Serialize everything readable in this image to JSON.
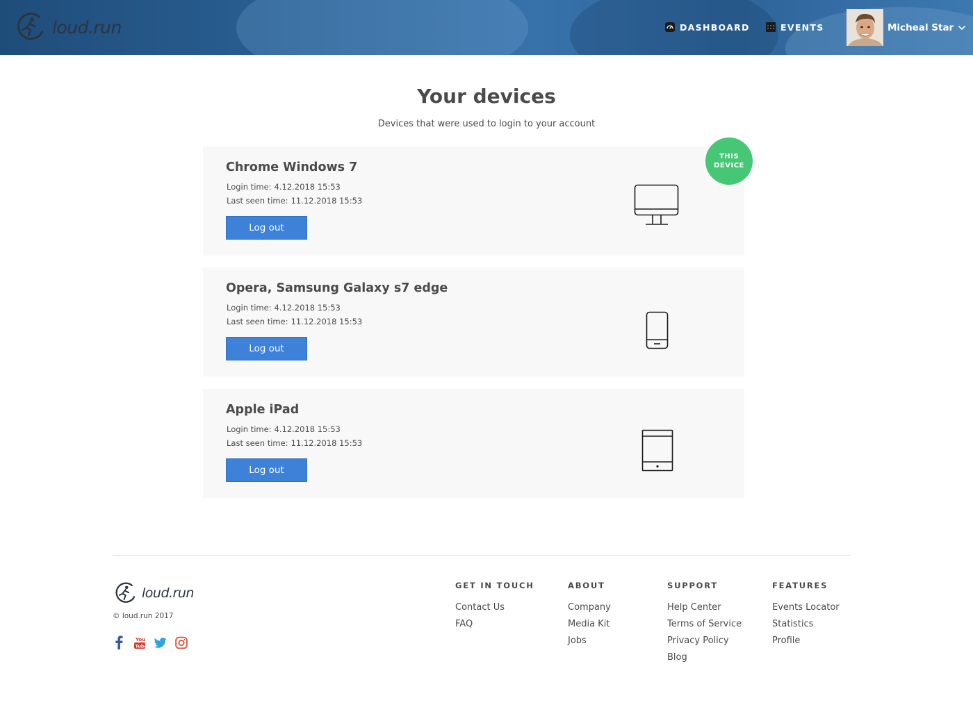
{
  "brand": {
    "name": "loud.run"
  },
  "nav": [
    {
      "label": "DASHBOARD",
      "icon": "dashboard-gauge-icon"
    },
    {
      "label": "EVENTS",
      "icon": "calendar-grid-icon"
    }
  ],
  "user": {
    "name": "Micheal Star"
  },
  "main": {
    "title": "Your devices",
    "subtitle": "Devices that were used to login to your account",
    "this_device_label": "THIS DEVICE",
    "devices": [
      {
        "name": "Chrome Windows 7",
        "login_label": "Login time:",
        "login_time": "4.12.2018 15:53",
        "seen_label": "Last seen time:",
        "seen_time": "11.12.2018 15:53",
        "button": "Log out",
        "icon": "desktop-monitor-icon"
      },
      {
        "name": "Opera, Samsung Galaxy s7 edge",
        "login_label": "Login time:",
        "login_time": "4.12.2018 15:53",
        "seen_label": "Last seen time:",
        "seen_time": "11.12.2018 15:53",
        "button": "Log out",
        "icon": "smartphone-icon"
      },
      {
        "name": "Apple iPad",
        "login_label": "Login time:",
        "login_time": "4.12.2018 15:53",
        "seen_label": "Last seen time:",
        "seen_time": "11.12.2018 15:53",
        "button": "Log out",
        "icon": "tablet-icon"
      }
    ]
  },
  "footer": {
    "copyright": "© loud.run 2017",
    "socials": [
      "facebook-icon",
      "youtube-icon",
      "twitter-icon",
      "instagram-icon"
    ],
    "columns": [
      {
        "heading": "GET IN TOUCH",
        "links": [
          "Contact Us",
          "FAQ"
        ]
      },
      {
        "heading": "ABOUT",
        "links": [
          "Company",
          "Media Kit",
          "Jobs"
        ]
      },
      {
        "heading": "SUPPORT",
        "links": [
          "Help Center",
          "Terms of Service",
          "Privacy Policy",
          "Blog"
        ]
      },
      {
        "heading": "FEATURES",
        "links": [
          "Events Locator",
          "Statistics",
          "Profile"
        ]
      }
    ]
  },
  "colors": {
    "accent": "#3d82d8",
    "this_device": "#46c776",
    "header": "#2d6499"
  }
}
